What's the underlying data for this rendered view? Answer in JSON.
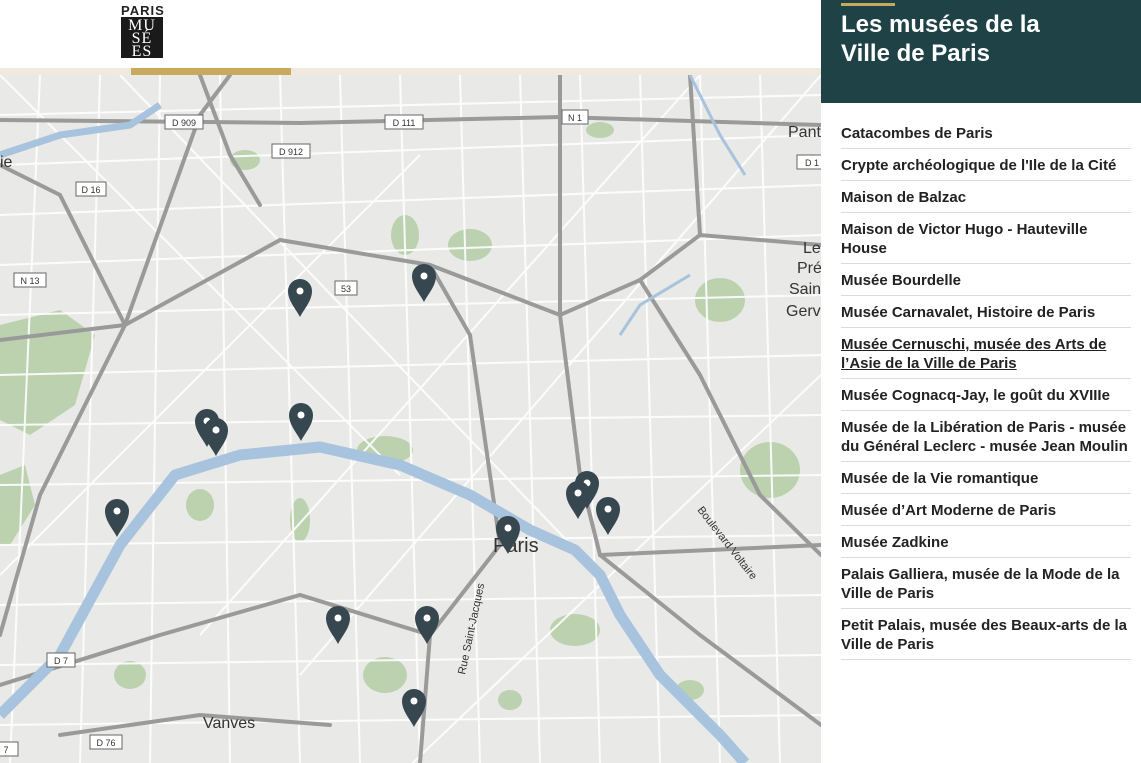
{
  "logo": {
    "top": "PARIS",
    "lines": [
      "MU",
      "SÉ",
      "ES"
    ]
  },
  "panel": {
    "title_line1": "Les musées de la",
    "title_line2": "Ville de Paris",
    "museums": [
      "Catacombes de Paris",
      "Crypte archéologique de l'Ile de la Cité",
      "Maison de Balzac",
      "Maison de Victor Hugo - Hauteville House",
      "Musée Bourdelle",
      "Musée Carnavalet, Histoire de Paris",
      "Musée Cernuschi, musée des Arts de l’Asie de la Ville de Paris",
      "Musée Cognacq-Jay, le goût du XVIIIe",
      "Musée de la Libération de Paris - musée du Général Leclerc - musée Jean Moulin",
      "Musée de la Vie romantique",
      "Musée d’Art Moderne de Paris",
      "Musée Zadkine",
      "Palais Galliera, musée de la Mode de la Ville de Paris",
      "Petit Palais, musée des Beaux-arts de la Ville de Paris"
    ]
  },
  "map": {
    "road_labels": [
      "D 909",
      "D 111",
      "N 1",
      "D 912",
      "D 16",
      "N 13",
      "53",
      "D 7",
      "D 76",
      "D 1"
    ],
    "place_labels": [
      "Paris",
      "Vanves",
      "Pant",
      "Le",
      "Pré",
      "Sain",
      "Gerva",
      "ie",
      "Boulevard Voltaire",
      "Rue Saint-Jacques",
      "7"
    ],
    "marker_color": "#37474f",
    "water_color": "#a7c3dd",
    "park_color": "#a9c79c"
  }
}
